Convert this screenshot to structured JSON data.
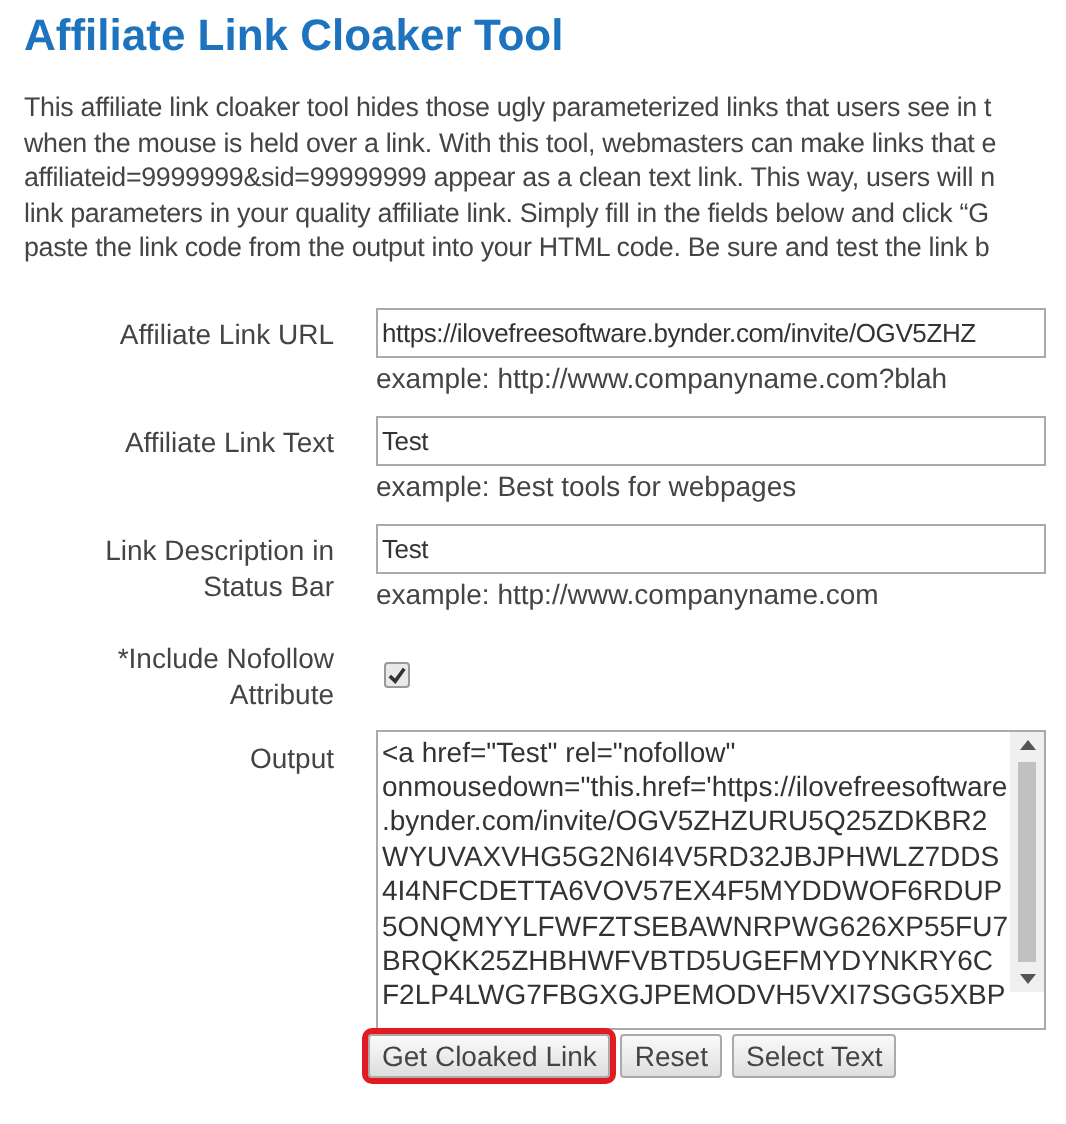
{
  "title": "Affiliate Link Cloaker Tool",
  "intro_lines": [
    "This affiliate link cloaker tool hides those ugly parameterized links that users see in t",
    "when the mouse is held over a link. With this tool, webmasters can make links that e",
    "affiliateid=9999999&sid=99999999 appear as a clean text link. This way, users will n",
    "link parameters in your quality affiliate link. Simply fill in the fields below and click “G",
    "paste the link code from the output into your HTML code. Be sure and test the link b"
  ],
  "fields": [
    {
      "kind": "text",
      "label": "Affiliate Link URL",
      "value": "https://ilovefreesoftware.bynder.com/invite/OGV5ZHZ",
      "hint": "example: http://www.companyname.com?blah"
    },
    {
      "kind": "text",
      "label": "Affiliate Link Text",
      "value": "Test",
      "hint": "example: Best tools for webpages"
    },
    {
      "kind": "text",
      "label": "Link Description in Status Bar",
      "value": "Test",
      "hint": "example: http://www.companyname.com"
    },
    {
      "kind": "checkbox",
      "label": "*Include Nofollow Attribute",
      "checked": true
    },
    {
      "kind": "output",
      "label": "Output",
      "lines": [
        "<a href=\"Test\" rel=\"nofollow\"",
        "onmousedown=\"this.href='https://ilovefreesoftware",
        ".bynder.com/invite/OGV5ZHZURU5Q25ZDKBR2",
        "WYUVAXVHG5G2N6I4V5RD32JBJPHWLZ7DDS",
        "4I4NFCDETTA6VOV57EX4F5MYDDWOF6RDUP",
        "5ONQMYYLFWFZTSEBAWNRPWG626XP55FU7",
        "BRQKK25ZHBHWFVBTD5UGEFMYDYNKRY6C",
        "F2LP4LWG7FBGXGJPEMODVH5VXI7SGG5XBP"
      ]
    }
  ],
  "buttons": [
    {
      "label": "Get Cloaked Link",
      "highlighted": true
    },
    {
      "label": "Reset",
      "highlighted": false
    },
    {
      "label": "Select Text",
      "highlighted": false
    }
  ]
}
